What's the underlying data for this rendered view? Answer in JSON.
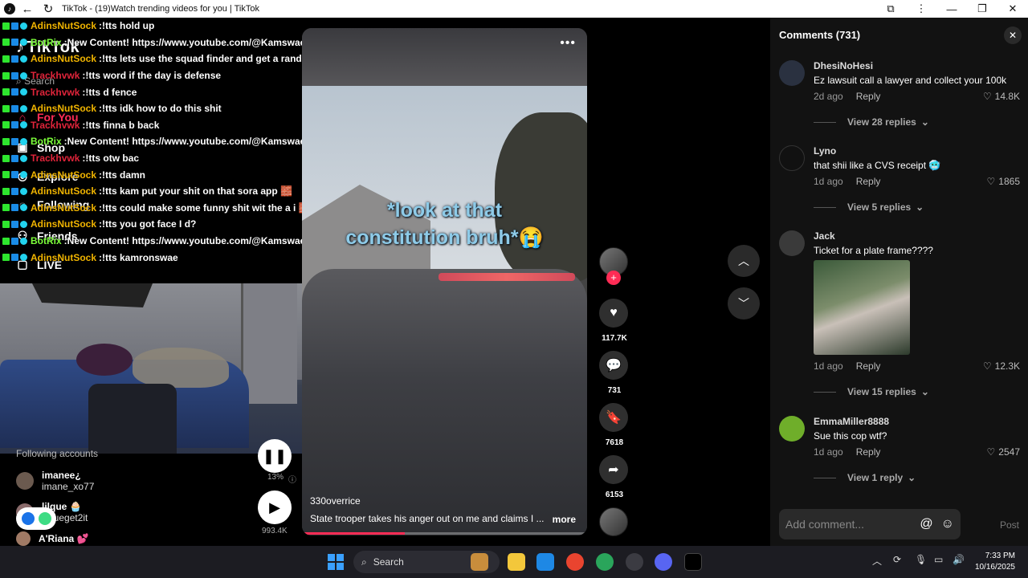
{
  "browser": {
    "title": "TikTok - (19)Watch trending videos for you | TikTok"
  },
  "sidebar": {
    "logo": "TikTok",
    "search_placeholder": "Search",
    "nav": [
      "For You",
      "Shop",
      "Explore",
      "Following",
      "Friends",
      "LIVE"
    ],
    "following_title": "Following accounts",
    "accounts": [
      {
        "name": "imanee¿",
        "handle": "imane_xo77"
      },
      {
        "name": "lilque 🧁",
        "handle": "lilqueget2it"
      },
      {
        "name": "A'Riana 💕",
        "handle": ""
      }
    ],
    "mini_percent": "13%",
    "mini_count": "993.4K"
  },
  "chat": [
    {
      "user": "AdinsNutSock",
      "color": "#f0b400",
      "msg": "!tts hold up"
    },
    {
      "user": "BotRix",
      "color": "#7cff3a",
      "msg": "New Content! https://www.youtube.com/@Kamswaelive"
    },
    {
      "user": "AdinsNutSock",
      "color": "#f0b400",
      "msg": "!tts lets use the squad finder and get a random"
    },
    {
      "user": "Trackhvwk",
      "color": "#e0243a",
      "msg": "!tts word if the day is defense"
    },
    {
      "user": "Trackhvwk",
      "color": "#e0243a",
      "msg": "!tts d fence"
    },
    {
      "user": "AdinsNutSock",
      "color": "#f0b400",
      "msg": "!tts idk how to do this shit"
    },
    {
      "user": "Trackhvwk",
      "color": "#e0243a",
      "msg": "!tts finna b back"
    },
    {
      "user": "BotRix",
      "color": "#7cff3a",
      "msg": "New Content! https://www.youtube.com/@Kamswaelive"
    },
    {
      "user": "Trackhvwk",
      "color": "#e0243a",
      "msg": "!tts otw bac"
    },
    {
      "user": "AdinsNutSock",
      "color": "#f0b400",
      "msg": "!tts damn"
    },
    {
      "user": "AdinsNutSock",
      "color": "#f0b400",
      "msg": "!tts kam put your shit on that sora app 🧱"
    },
    {
      "user": "AdinsNutSock",
      "color": "#f0b400",
      "msg": "!tts could make some funny shit wit the a i 🧱"
    },
    {
      "user": "AdinsNutSock",
      "color": "#f0b400",
      "msg": "!tts you got face I d?"
    },
    {
      "user": "BotRix",
      "color": "#7cff3a",
      "msg": "New Content! https://www.youtube.com/@Kamswaelive"
    },
    {
      "user": "AdinsNutSock",
      "color": "#f0b400",
      "msg": "!tts kamronswae"
    }
  ],
  "video": {
    "caption_line1": "*look at that",
    "caption_line2": "constitution bruh*😭",
    "author": "330overrice",
    "description": "State trooper takes his anger out on me and claims I ...",
    "more": "more",
    "progress": 0.36,
    "menu": "•••"
  },
  "actions": {
    "likes": "117.7K",
    "comments": "731",
    "saves": "7618",
    "shares": "6153"
  },
  "comments": {
    "title": "Comments (731)",
    "items": [
      {
        "user": "DhesiNoHesi",
        "text": "Ez lawsuit call a lawyer and collect your 100k",
        "time": "2d ago",
        "reply": "Reply",
        "likes": "14.8K",
        "view": "View 28 replies",
        "avatar_color": "#2a3140"
      },
      {
        "user": "Lyno",
        "text": "that shii like a CVS receipt 🥶",
        "time": "1d ago",
        "reply": "Reply",
        "likes": "1865",
        "view": "View 5 replies",
        "avatar_color": "#111111"
      },
      {
        "user": "Jack",
        "text": "Ticket for a plate frame????",
        "time": "1d ago",
        "reply": "Reply",
        "likes": "12.3K",
        "view": "View 15 replies",
        "avatar_color": "#3a3a3a"
      },
      {
        "user": "EmmaMiller8888",
        "text": "Sue this cop wtf?",
        "time": "1d ago",
        "reply": "Reply",
        "likes": "2547",
        "view": "View 1 reply",
        "avatar_color": "#6fae2a"
      }
    ],
    "add_placeholder": "Add comment...",
    "post": "Post"
  },
  "taskbar": {
    "search": "Search",
    "time": "7:33 PM",
    "date": "10/16/2025"
  }
}
